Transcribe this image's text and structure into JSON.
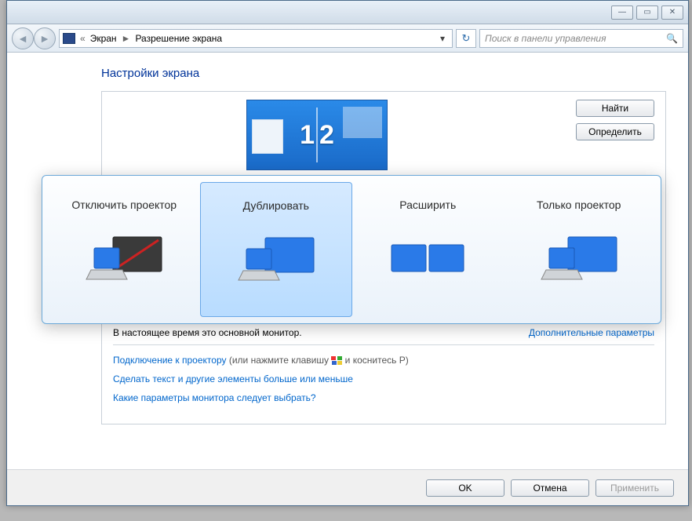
{
  "titlebar": {
    "min": "—",
    "max": "▭",
    "close": "✕"
  },
  "nav": {
    "back": "◄",
    "fwd": "►",
    "sep1": "«",
    "crumb1": "Экран",
    "sep2": "►",
    "crumb2": "Разрешение экрана",
    "dropdown": "▾",
    "refresh": "↻",
    "search_placeholder": "Поиск в панели управления",
    "search_icon": "🔍"
  },
  "page": {
    "title": "Настройки экрана",
    "find_btn": "Найти",
    "detect_btn": "Определить",
    "preview_num1": "1",
    "preview_num2": "2",
    "status_text": "В настоящее время это основной монитор.",
    "advanced_link": "Дополнительные параметры",
    "link1_a": "Подключение к проектору",
    "link1_b": " (или нажмите клавишу ",
    "link1_c": " и коснитесь P)",
    "link2": "Сделать текст и другие элементы больше или меньше",
    "link3": "Какие параметры монитора следует выбрать?"
  },
  "footer": {
    "ok": "OK",
    "cancel": "Отмена",
    "apply": "Применить"
  },
  "projector": {
    "options": [
      {
        "label": "Отключить проектор"
      },
      {
        "label": "Дублировать"
      },
      {
        "label": "Расширить"
      },
      {
        "label": "Только проектор"
      }
    ],
    "selected_index": 1
  }
}
